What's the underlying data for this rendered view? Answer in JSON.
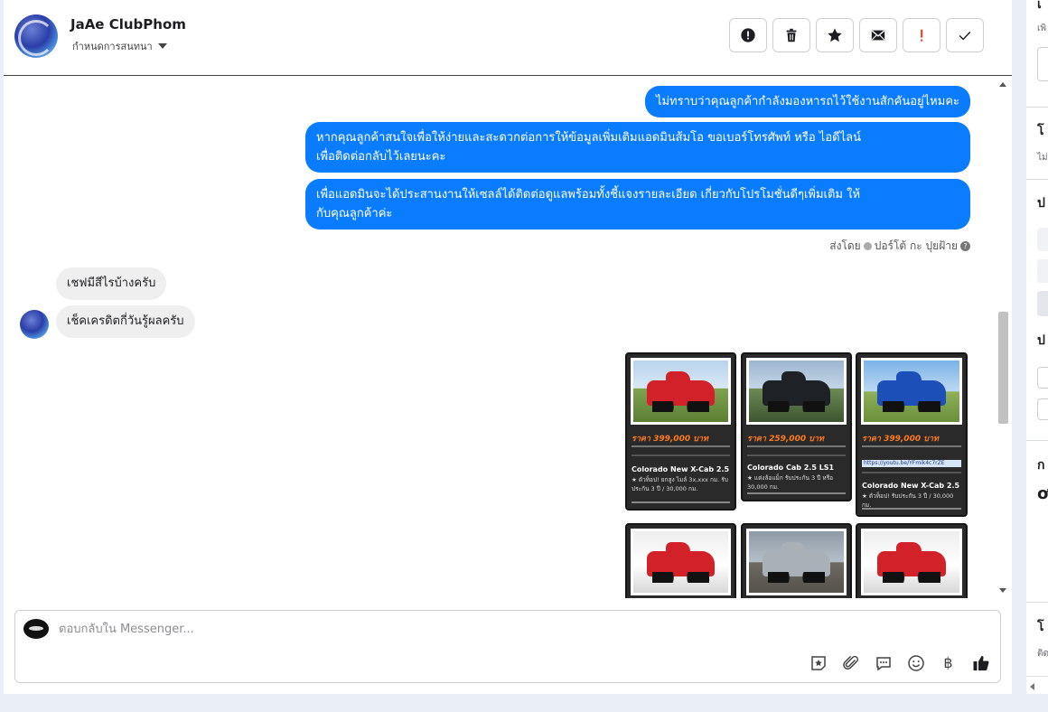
{
  "header": {
    "contact_name": "JaAe ClubPhom",
    "assign_label": "กำหนดการสนทนา",
    "toolbar": [
      "spam-icon",
      "trash-icon",
      "star-icon",
      "mail-icon",
      "alert-icon",
      "check-icon"
    ]
  },
  "messages": {
    "outgoing": [
      "ไม่ทราบว่าคุณลูกค้ากำลังมองหารถไว้ใช้งานสักคันอยู่ไหมคะ",
      "หากคุณลูกค้าสนใจเพื่อให้ง่ายและสะดวกต่อการให้ข้อมูลเพิ่มเติมแอดมินส้มโอ ขอเบอร์โทรศัพท์ หรือ ไอดีไลน์",
      "เพื่อติดต่อกลับไว้เลยนะคะ",
      "เพื่อแอดมินจะได้ประสานงานให้เซลล์ได้ติดต่อดูแลพร้อมทั้งชี้แจงรายละเอียด เกี่ยวกับโปรโมชั่นดีๆเพิ่มเติม ให้",
      "กับคุณลูกค้าค่ะ"
    ],
    "sent_by_label": "ส่งโดย",
    "sent_by_name": "ปอร์โต้ กะ ปุยฝ้าย",
    "incoming": [
      "เชฟมีสีไรบ้างครับ",
      "เช็คเครดิตกี่วันรู้ผลครับ"
    ]
  },
  "cards": [
    {
      "price": "ราคา 399,000 บาท",
      "model": "Colorado New X-Cab 2.5",
      "desc": "★ ตัวท็อป! ยกสูง ไมล์ 3x,xxx กม. รับประกัน 3 ปี / 30,000 กม."
    },
    {
      "price": "ราคา 259,000 บาท",
      "model": "Colorado Cab 2.5 LS1",
      "desc": "★ แต่งล้อแม็ก รับประกัน 3 ปี หรือ 30,000 กม."
    },
    {
      "price": "ราคา 399,000 บาท",
      "model": "Colorado New X-Cab 2.5",
      "desc": "★ ตัวท็อป! รับประกัน 3 ปี / 30,000 กม.",
      "link": "https://youtu.be/YFmik4c7rZE"
    }
  ],
  "composer": {
    "placeholder": "ตอบกลับใน Messenger...",
    "tools": [
      "sticker-icon",
      "attach-icon",
      "saved-reply-icon",
      "emoji-icon",
      "baht-icon",
      "like-icon"
    ],
    "baht_symbol": "฿"
  },
  "right_panel": {
    "glyphs": [
      "เ",
      "โ",
      "ป",
      "ป",
      "ก",
      "ơ",
      "โ"
    ],
    "small": [
      "เพิ",
      "ไม่",
      "ติด"
    ]
  }
}
